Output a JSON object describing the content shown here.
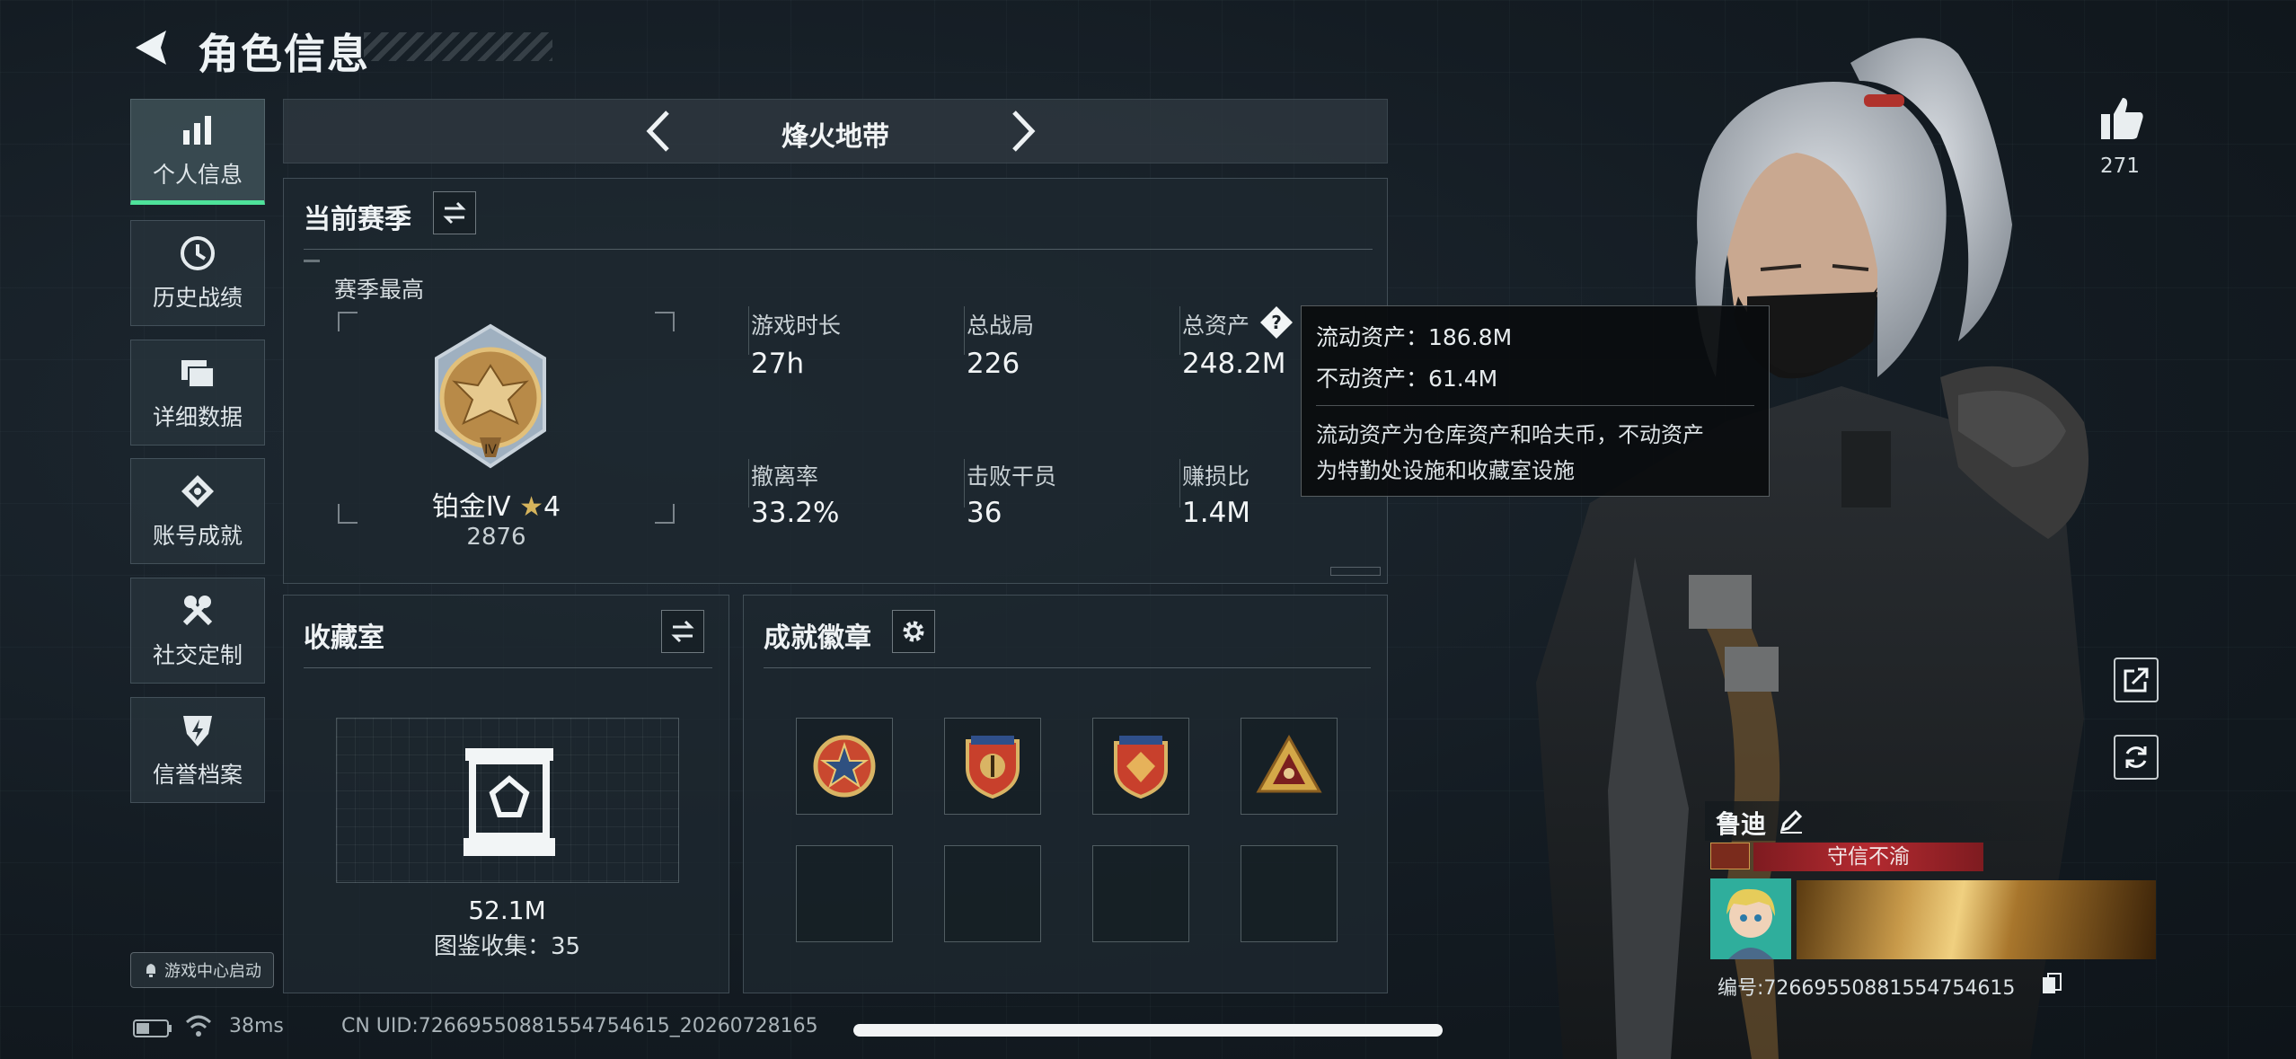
{
  "header": {
    "title": "角色信息"
  },
  "nav": [
    {
      "label": "个人信息",
      "icon": "bar-chart-icon",
      "active": true
    },
    {
      "label": "历史战绩",
      "icon": "clock-icon"
    },
    {
      "label": "详细数据",
      "icon": "folder-icon"
    },
    {
      "label": "账号成就",
      "icon": "medal-icon"
    },
    {
      "label": "社交定制",
      "icon": "tools-icon"
    },
    {
      "label": "信誉档案",
      "icon": "shield-bolt-icon"
    }
  ],
  "launch_label": "游戏中心启动",
  "mode": {
    "title": "烽火地带"
  },
  "season": {
    "title": "当前赛季",
    "best_label": "赛季最高",
    "rank_name": "铂金Ⅳ",
    "rank_stars": "4",
    "rank_score": "2876",
    "stats": [
      {
        "label": "游戏时长",
        "value": "27h"
      },
      {
        "label": "总战局",
        "value": "226"
      },
      {
        "label": "总资产",
        "value": "248.2M",
        "has_help": true
      },
      {
        "label": "撤离率",
        "value": "33.2%"
      },
      {
        "label": "击败干员",
        "value": "36"
      },
      {
        "label": "赚损比",
        "value": "1.4M"
      }
    ]
  },
  "tooltip": {
    "liquid": "流动资产：186.8M",
    "fixed": "不动资产：61.4M",
    "note_1": "流动资产为仓库资产和哈夫币，不动资产",
    "note_2": "为特勤处设施和收藏室设施"
  },
  "collection": {
    "title": "收藏室",
    "value": "52.1M",
    "count_text": "图鉴收集：35"
  },
  "achievements": {
    "title": "成就徽章"
  },
  "likes": {
    "count": "271"
  },
  "profile": {
    "name": "鲁迪",
    "title_tag": "守信不渝",
    "id_text": "编号:72669550881554754615"
  },
  "status_bar": {
    "ping": "38ms",
    "uid": "CN UID:72669550881554754615_20260728165"
  },
  "colors": {
    "accent_green": "#4ee29a",
    "tag_red": "#a8232a",
    "gold": "#c89a4a"
  }
}
